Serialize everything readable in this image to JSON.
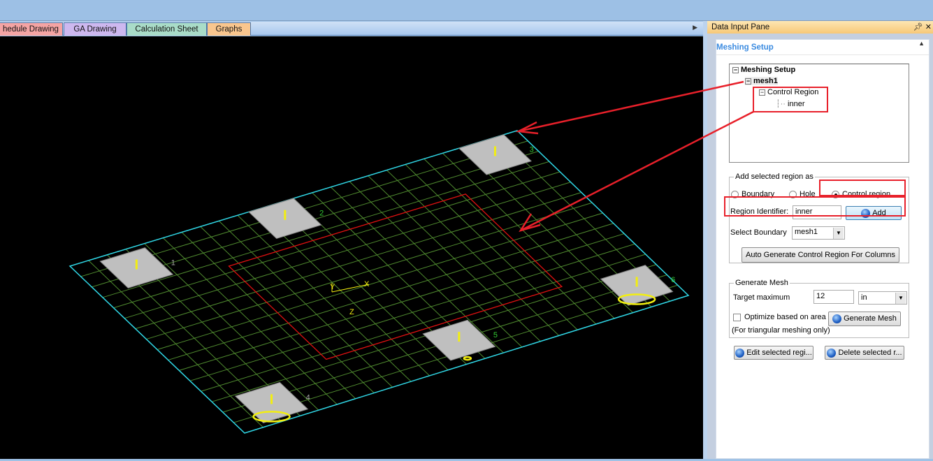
{
  "tabs": [
    {
      "label": "hedule Drawing",
      "color": "#f4a4a4"
    },
    {
      "label": "GA Drawing",
      "color": "#cdb8ef"
    },
    {
      "label": "Calculation Sheet",
      "color": "#a9dcc8"
    },
    {
      "label": "Graphs",
      "color": "#f9c68e"
    }
  ],
  "viewport": {
    "axes": {
      "x": "X",
      "y": "Y",
      "z": "Z"
    },
    "columns": [
      {
        "label": "1"
      },
      {
        "label": "2"
      },
      {
        "label": "3"
      },
      {
        "label": "4"
      },
      {
        "label": "5"
      },
      {
        "label": "6"
      }
    ],
    "colors": {
      "grid": "#4f8a2f",
      "border": "#2fd6e6",
      "control_region": "#e01010",
      "column": "#bfbfbf",
      "load": "#f2ee10",
      "annotation": "#e8202a"
    }
  },
  "pane": {
    "title": "Data Input Pane",
    "pin_icon": "pin-icon",
    "close_label": "✕",
    "section_title": "Meshing Setup",
    "tree": {
      "root": "Meshing Setup",
      "mesh": "mesh1",
      "region_group": "Control Region",
      "region": "inner"
    },
    "add_region": {
      "legend": "Add selected region as",
      "options": [
        {
          "label": "Boundary",
          "selected": false
        },
        {
          "label": "Hole",
          "selected": false
        },
        {
          "label": "Control region",
          "selected": true
        }
      ],
      "identifier_label": "Region Identifier:",
      "identifier_value": "inner",
      "add_label": "Add",
      "boundary_label": "Select Boundary",
      "boundary_value": "mesh1",
      "auto_label": "Auto Generate Control Region For Columns"
    },
    "generate": {
      "legend": "Generate Mesh",
      "target_label": "Target maximum",
      "target_value": "12",
      "unit": "in",
      "optimize_label": "Optimize based on area",
      "optimize_checked": false,
      "note": "(For triangular meshing only)",
      "generate_label": "Generate Mesh"
    },
    "edit_label": "Edit selected regi...",
    "delete_label": "Delete selected r..."
  }
}
